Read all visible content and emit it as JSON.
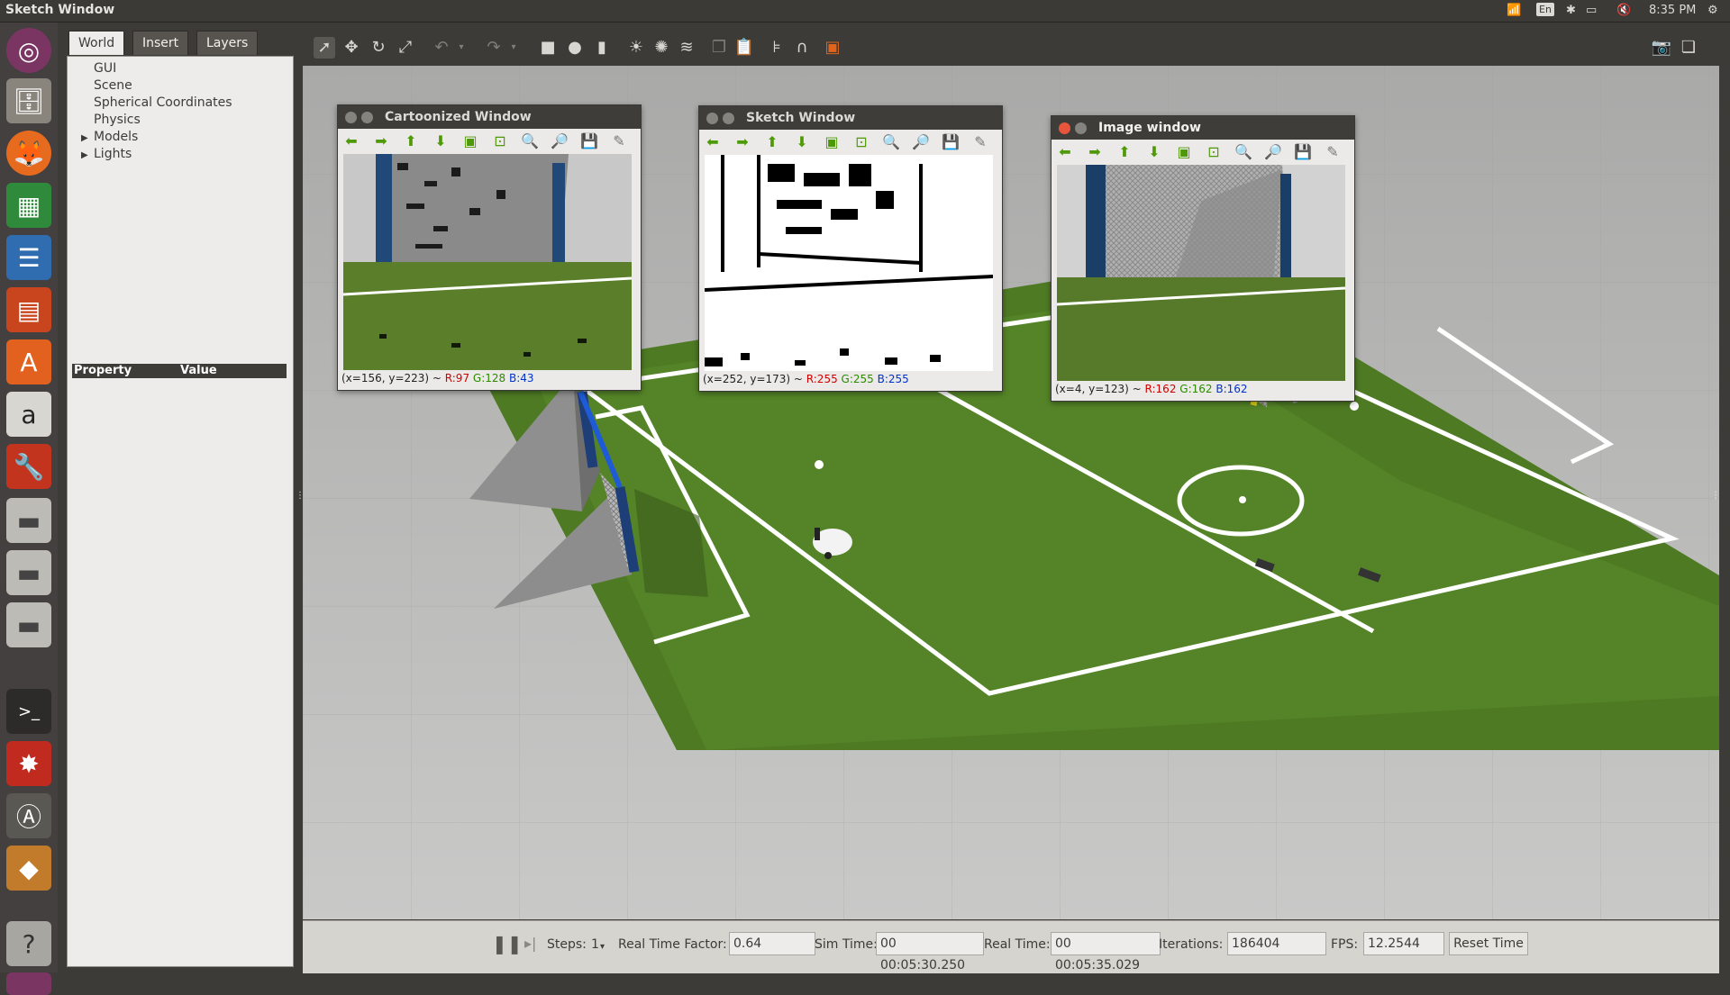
{
  "window": {
    "title": "Sketch Window"
  },
  "tray": {
    "lang": "En",
    "time": "8:35 PM"
  },
  "left": {
    "tabs": [
      "World",
      "Insert",
      "Layers"
    ],
    "tree": [
      {
        "label": "GUI",
        "expandable": false
      },
      {
        "label": "Scene",
        "expandable": false
      },
      {
        "label": "Spherical Coordinates",
        "expandable": false
      },
      {
        "label": "Physics",
        "expandable": false
      },
      {
        "label": "Models",
        "expandable": true
      },
      {
        "label": "Lights",
        "expandable": true
      }
    ],
    "property_header": "Property",
    "value_header": "Value"
  },
  "cv_windows": [
    {
      "title": "Cartoonized Window",
      "coords": "(x=156, y=223) ~ ",
      "r": "R:97",
      "g": "G:128",
      "b": "B:43"
    },
    {
      "title": "Sketch Window",
      "coords": "(x=252, y=173) ~ ",
      "r": "R:255",
      "g": "G:255",
      "b": "B:255"
    },
    {
      "title": "Image window",
      "coords": "(x=4, y=123) ~ ",
      "r": "R:162",
      "g": "G:162",
      "b": "B:162"
    }
  ],
  "bottom": {
    "steps_label": "Steps:",
    "steps_value": "1",
    "rtf_label": "Real Time Factor:",
    "rtf_value": "0.64",
    "sim_label": "Sim Time:",
    "sim_value": "00 00:05:30.250",
    "real_label": "Real Time:",
    "real_value": "00 00:05:35.029",
    "iter_label": "Iterations:",
    "iter_value": "186404",
    "fps_label": "FPS:",
    "fps_value": "12.2544",
    "reset_label": "Reset Time"
  }
}
